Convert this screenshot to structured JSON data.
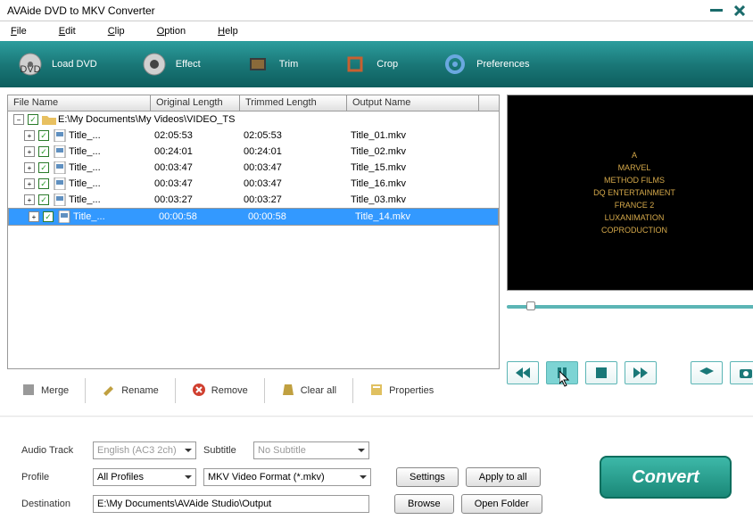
{
  "title": "AVAide DVD to MKV Converter",
  "menu": [
    "File",
    "Edit",
    "Clip",
    "Option",
    "Help"
  ],
  "toolbar": [
    {
      "label": "Load DVD",
      "icon": "dvd"
    },
    {
      "label": "Effect",
      "icon": "effect"
    },
    {
      "label": "Trim",
      "icon": "trim"
    },
    {
      "label": "Crop",
      "icon": "crop"
    },
    {
      "label": "Preferences",
      "icon": "gear"
    }
  ],
  "columns": {
    "c1": "File Name",
    "c2": "Original Length",
    "c3": "Trimmed Length",
    "c4": "Output Name"
  },
  "folder": "E:\\My Documents\\My Videos\\VIDEO_TS",
  "rows": [
    {
      "name": "Title_...",
      "orig": "02:05:53",
      "trim": "02:05:53",
      "out": "Title_01.mkv",
      "sel": false
    },
    {
      "name": "Title_...",
      "orig": "00:24:01",
      "trim": "00:24:01",
      "out": "Title_02.mkv",
      "sel": false
    },
    {
      "name": "Title_...",
      "orig": "00:03:47",
      "trim": "00:03:47",
      "out": "Title_15.mkv",
      "sel": false
    },
    {
      "name": "Title_...",
      "orig": "00:03:47",
      "trim": "00:03:47",
      "out": "Title_16.mkv",
      "sel": false
    },
    {
      "name": "Title_...",
      "orig": "00:03:27",
      "trim": "00:03:27",
      "out": "Title_03.mkv",
      "sel": false
    },
    {
      "name": "Title_...",
      "orig": "00:00:58",
      "trim": "00:00:58",
      "out": "Title_14.mkv",
      "sel": true
    }
  ],
  "actions": [
    {
      "label": "Merge",
      "icon": "merge"
    },
    {
      "label": "Rename",
      "icon": "rename"
    },
    {
      "label": "Remove",
      "icon": "remove"
    },
    {
      "label": "Clear all",
      "icon": "clear"
    },
    {
      "label": "Properties",
      "icon": "props"
    }
  ],
  "preview": [
    "A",
    "MARVEL",
    "METHOD FILMS",
    "DQ ENTERTAINMENT",
    "FRANCE 2",
    "LUXANIMATION",
    "COPRODUCTION"
  ],
  "form": {
    "audio_lbl": "Audio Track",
    "audio_val": "English (AC3 2ch)",
    "sub_lbl": "Subtitle",
    "sub_val": "No Subtitle",
    "profile_lbl": "Profile",
    "profile1": "All Profiles",
    "profile2": "MKV Video Format (*.mkv)",
    "dest_lbl": "Destination",
    "dest_val": "E:\\My Documents\\AVAide Studio\\Output",
    "settings": "Settings",
    "apply": "Apply to all",
    "browse": "Browse",
    "openfolder": "Open Folder",
    "convert": "Convert"
  }
}
